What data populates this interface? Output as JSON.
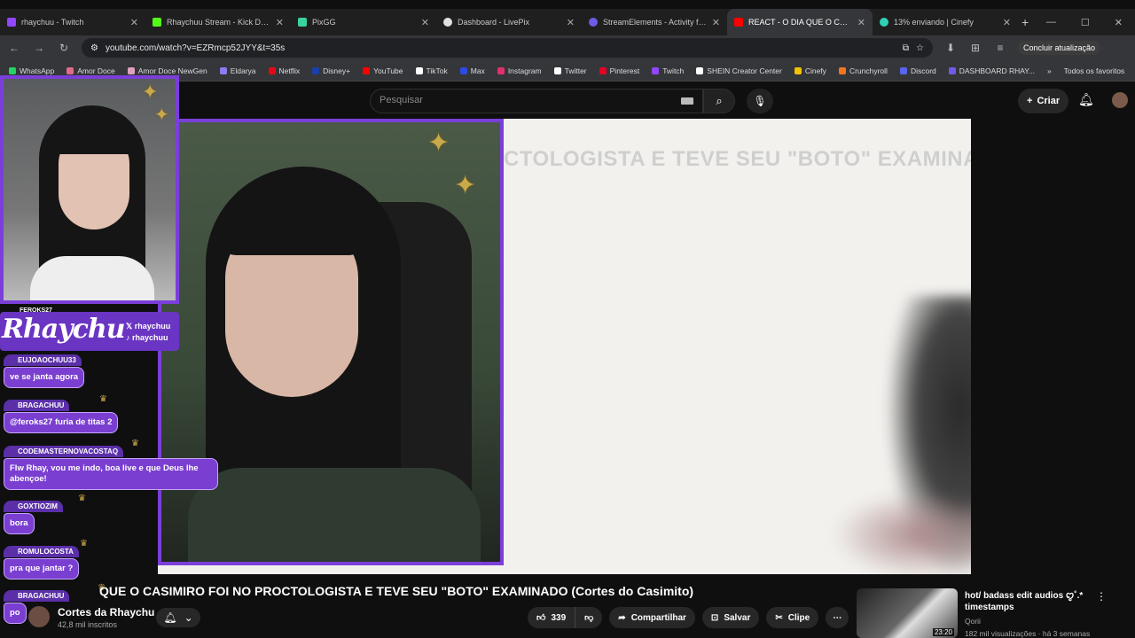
{
  "tabs": [
    {
      "title": "rhaychuu - Twitch",
      "color": "#9146ff"
    },
    {
      "title": "Rhaychuu Stream - Kick Dashbo",
      "color": "#53fc18"
    },
    {
      "title": "PixGG",
      "color": "#3ad29f"
    },
    {
      "title": "Dashboard - LivePix",
      "color": "#e0e0e0"
    },
    {
      "title": "StreamElements - Activity feed",
      "color": "#6c5ce7"
    },
    {
      "title": "REACT - O DIA QUE O CASIMIR",
      "color": "#ff0000"
    },
    {
      "title": "13% enviando | Cinefy",
      "color": "#2fd2b3"
    }
  ],
  "address": {
    "url": "youtube.com/watch?v=EZRmcp52JYY&t=35s",
    "update_label": "Concluir atualização"
  },
  "bookmarks": [
    {
      "label": "WhatsApp",
      "color": "#25d366"
    },
    {
      "label": "Amor Doce",
      "color": "#e06b8b"
    },
    {
      "label": "Amor Doce NewGen",
      "color": "#e0a0c0"
    },
    {
      "label": "Eldarya",
      "color": "#8c7cf0"
    },
    {
      "label": "Netflix",
      "color": "#e50914"
    },
    {
      "label": "Disney+",
      "color": "#1a3fa8"
    },
    {
      "label": "YouTube",
      "color": "#ff0000"
    },
    {
      "label": "TikTok",
      "color": "#ffffff"
    },
    {
      "label": "Max",
      "color": "#2c4be0"
    },
    {
      "label": "Instagram",
      "color": "#e1306c"
    },
    {
      "label": "Twitter",
      "color": "#ffffff"
    },
    {
      "label": "Pinterest",
      "color": "#e60023"
    },
    {
      "label": "Twitch",
      "color": "#9146ff"
    },
    {
      "label": "SHEIN Creator Center",
      "color": "#ffffff"
    },
    {
      "label": "Cinefy",
      "color": "#f2c300"
    },
    {
      "label": "Crunchyroll",
      "color": "#f47521"
    },
    {
      "label": "Discord",
      "color": "#5865f2"
    },
    {
      "label": "DASHBOARD RHAY...",
      "color": "#6c5ce7"
    }
  ],
  "bookmarks_overflow": "»",
  "bookmarks_all": "Todos os favoritos",
  "youtube": {
    "search_placeholder": "Pesquisar",
    "create_label": "Criar",
    "video_caption": "CTOLOGISTA E TEVE SEU \"BOTO\" EXAMINAD",
    "video_title": "QUE O CASIMIRO FOI NO PROCTOLOGISTA E TEVE SEU \"BOTO\" EXAMINADO (Cortes do Casimito)",
    "channel_name": "Cortes da Rhaychu",
    "channel_subs": "42,8 mil inscritos",
    "likes": "339",
    "share_label": "Compartilhar",
    "save_label": "Salvar",
    "clip_label": "Clipe",
    "rec": {
      "title": "hot/ badass edit audios ꨄ˚.* timestamps",
      "channel": "Qorii",
      "meta": "182 mil visualizações · há 3 semanas",
      "duration": "23:20"
    }
  },
  "overlay": {
    "logo": "Rhaychu",
    "handle_x": "rhaychuu",
    "handle_tiktok": "rhaychuu",
    "top_user": "FEROKS27",
    "accent": "#7b3fd9"
  },
  "chat": [
    {
      "user": "EUJOAOCHUU33",
      "text": "ve se janta agora"
    },
    {
      "user": "BRAGACHUU",
      "text": "@feroks27 furia de titas 2"
    },
    {
      "user": "CODEMASTERNOVACOSTAQ",
      "text": "Flw Rhay, vou me indo, boa live e que Deus lhe abençoe!"
    },
    {
      "user": "GOXTIOZIM",
      "text": "bora"
    },
    {
      "user": "ROMULOCOSTA",
      "text": "pra que jantar ?"
    },
    {
      "user": "BRAGACHUU",
      "text": "po"
    }
  ]
}
